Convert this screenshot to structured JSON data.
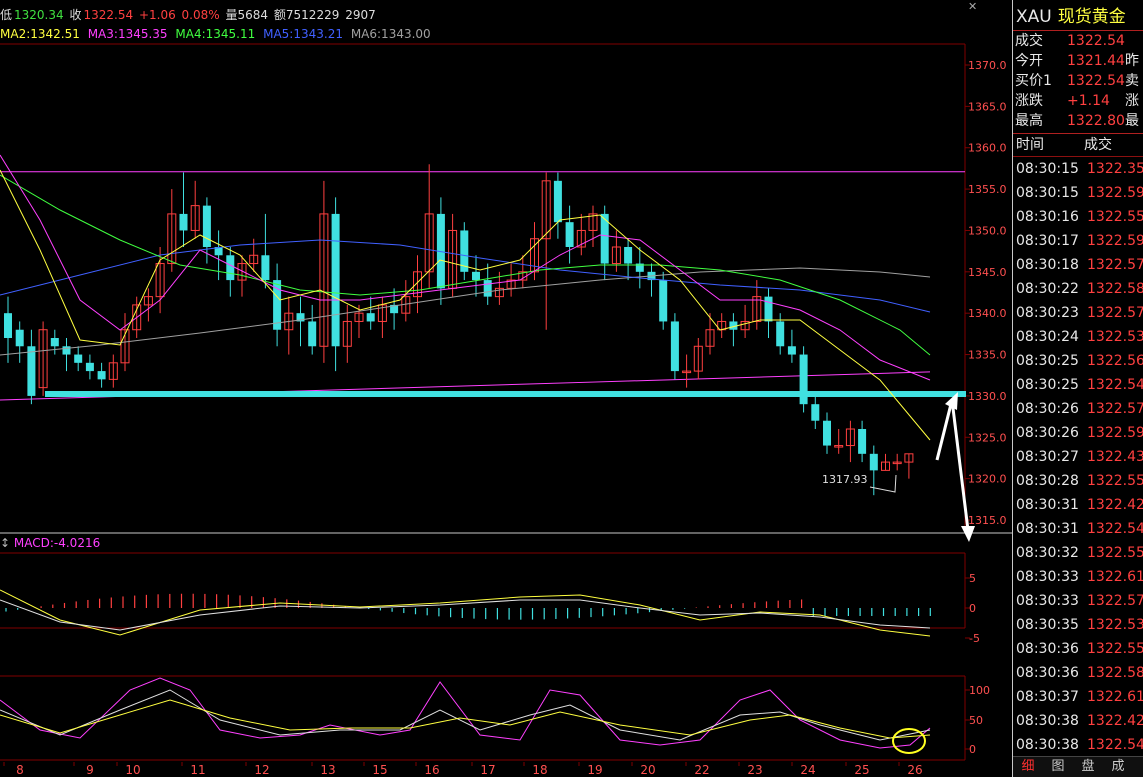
{
  "topbar": {
    "low_label": "低",
    "low_value": "1320.34",
    "close_label": "收",
    "close_value": "1322.54",
    "change": "+1.06",
    "change_pct": "0.08%",
    "volume_label": "量",
    "volume_value": "5684",
    "amount_label": "额",
    "amount_value": "7512229",
    "extra_value": "2907"
  },
  "ma_line": [
    {
      "label": "MA2:1342.51",
      "color": "#ffff40"
    },
    {
      "label": "MA3:1345.35",
      "color": "#ff40ff"
    },
    {
      "label": "MA4:1345.11",
      "color": "#40ff40"
    },
    {
      "label": "MA5:1343.21",
      "color": "#4060ff"
    },
    {
      "label": "MA6:1343.00",
      "color": "#a0a0a0"
    }
  ],
  "price_axis": [
    "1370.0",
    "1365.0",
    "1360.0",
    "1355.0",
    "1350.0",
    "1345.0",
    "1340.0",
    "1335.0",
    "1330.0",
    "1325.0",
    "1320.0",
    "1315.0"
  ],
  "low_annotation": "1317.93",
  "macd": {
    "label": "MACD:-4.0216",
    "axis": [
      "5",
      "0",
      "-5"
    ]
  },
  "kdj": {
    "axis": [
      "100",
      "50",
      "0"
    ]
  },
  "dates": [
    "8",
    "9",
    "10",
    "11",
    "12",
    "13",
    "15",
    "16",
    "17",
    "18",
    "19",
    "20",
    "22",
    "23",
    "24",
    "25",
    "26"
  ],
  "quote": {
    "code": "XAU",
    "name": "现货黄金",
    "rows": [
      {
        "label": "成交",
        "value": "1322.54",
        "extra": ""
      },
      {
        "label": "今开",
        "value": "1321.44",
        "extra": "昨"
      },
      {
        "label": "买价1",
        "value": "1322.54",
        "extra": "卖"
      },
      {
        "label": "涨跌",
        "value": "+1.14",
        "extra": "涨"
      },
      {
        "label": "最高",
        "value": "1322.80",
        "extra": "最"
      }
    ]
  },
  "ticks": {
    "header_time": "时间",
    "header_price": "成交",
    "rows": [
      {
        "time": "08:30:15",
        "price": "1322.35",
        "color": "#ff4040"
      },
      {
        "time": "08:30:15",
        "price": "1322.59",
        "color": "#ff4040"
      },
      {
        "time": "08:30:16",
        "price": "1322.55",
        "color": "#ff4040"
      },
      {
        "time": "08:30:17",
        "price": "1322.59",
        "color": "#ff4040"
      },
      {
        "time": "08:30:18",
        "price": "1322.57",
        "color": "#ff4040"
      },
      {
        "time": "08:30:22",
        "price": "1322.58",
        "color": "#ff4040"
      },
      {
        "time": "08:30:23",
        "price": "1322.57",
        "color": "#ff4040"
      },
      {
        "time": "08:30:24",
        "price": "1322.53",
        "color": "#ff4040"
      },
      {
        "time": "08:30:25",
        "price": "1322.56",
        "color": "#ff4040"
      },
      {
        "time": "08:30:25",
        "price": "1322.54",
        "color": "#ff4040"
      },
      {
        "time": "08:30:26",
        "price": "1322.57",
        "color": "#ff4040"
      },
      {
        "time": "08:30:26",
        "price": "1322.59",
        "color": "#ff4040"
      },
      {
        "time": "08:30:27",
        "price": "1322.43",
        "color": "#ff4040"
      },
      {
        "time": "08:30:28",
        "price": "1322.55",
        "color": "#ff4040"
      },
      {
        "time": "08:30:31",
        "price": "1322.42",
        "color": "#ff4040"
      },
      {
        "time": "08:30:31",
        "price": "1322.54",
        "color": "#ff4040"
      },
      {
        "time": "08:30:32",
        "price": "1322.55",
        "color": "#ff4040"
      },
      {
        "time": "08:30:33",
        "price": "1322.61",
        "color": "#ff4040"
      },
      {
        "time": "08:30:33",
        "price": "1322.57",
        "color": "#ff4040"
      },
      {
        "time": "08:30:35",
        "price": "1322.53",
        "color": "#ff4040"
      },
      {
        "time": "08:30:36",
        "price": "1322.55",
        "color": "#ff4040"
      },
      {
        "time": "08:30:36",
        "price": "1322.58",
        "color": "#ff4040"
      },
      {
        "time": "08:30:37",
        "price": "1322.61",
        "color": "#ff4040"
      },
      {
        "time": "08:30:38",
        "price": "1322.42",
        "color": "#ff4040"
      },
      {
        "time": "08:30:38",
        "price": "1322.54",
        "color": "#ff4040"
      }
    ]
  },
  "tabs": [
    "细",
    "图",
    "盘",
    "成"
  ],
  "colors": {
    "up": "#ff4040",
    "down": "#40e0e0",
    "ma2": "#ffff40",
    "ma3": "#ff40ff",
    "ma4": "#40ff40",
    "ma5": "#4060ff",
    "ma6": "#a0a0a0",
    "support": "#40e0e0",
    "grid": "#800000"
  }
}
